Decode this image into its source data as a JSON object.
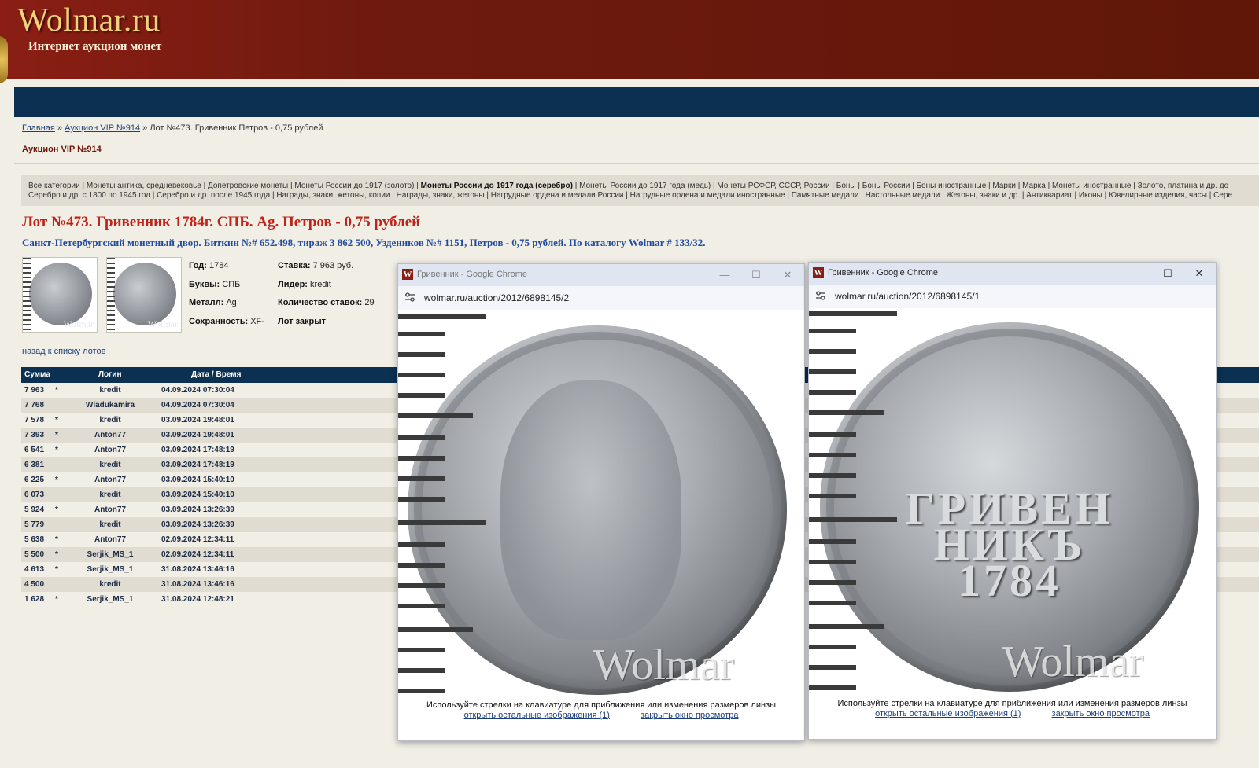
{
  "site": {
    "title": "Wolmar.ru",
    "subtitle": "Интернет аукцион монет"
  },
  "breadcrumb": {
    "home": "Главная",
    "sep1": " » ",
    "auction": "Аукцион VIP №914",
    "sep2": " » ",
    "current": "Лот №473. Гривенник Петров - 0,75 рублей"
  },
  "auction_title": "Аукцион VIP №914",
  "categories": {
    "line1_a": "Все категории | Монеты антика, средневековье | Допетровские монеты | Монеты России до 1917 (золото) | ",
    "line1_bold": "Монеты России до 1917 года (серебро)",
    "line1_b": " | Монеты России до 1917 года (медь) | Монеты РСФСР, СССР, России | Боны | Боны России | Боны иностранные | Марки | Марка | Монеты иностранные | Золото, платина и др. до",
    "line2": "Серебро и др. с 1800 по 1945 год | Серебро и др. после 1945 года | Награды, знаки, жетоны, копии | Награды, знаки, жетоны | Нагрудные ордена и медали России | Нагрудные ордена и медали иностранные | Памятные медали | Настольные медали | Жетоны, знаки и др. | Антиквариат | Иконы | Ювелирные изделия, часы | Сере"
  },
  "lot": {
    "title": "Лот №473.  Гривенник 1784г. СПБ. Ag. Петров - 0,75 рублей",
    "description": "Санкт-Петербургский монетный двор. Биткин №# 652.498, тираж 3 862 500, Уздеников №# 1151, Петров - 0,75 рублей. По каталогу Wolmar # 133/32.",
    "thumb_watermark": "Wolmar",
    "year_label": "Год:",
    "year": "1784",
    "letters_label": "Буквы:",
    "letters": "СПБ",
    "metal_label": "Металл:",
    "metal": "Ag",
    "grade_label": "Сохранность:",
    "grade": "XF-",
    "bid_label": "Ставка:",
    "bid": "7 963 руб.",
    "leader_label": "Лидер:",
    "leader": "kredit",
    "bids_count_label": "Количество ставок:",
    "bids_count": "29",
    "status": "Лот закрыт"
  },
  "back_link": "назад к списку лотов",
  "bids_table": {
    "headers": {
      "sum": "Сумма",
      "login": "Логин",
      "date": "Дата / Время"
    },
    "rows": [
      {
        "sum": "7 963",
        "star": "*",
        "login": "kredit",
        "date": "04.09.2024 07:30:04"
      },
      {
        "sum": "7 768",
        "star": "",
        "login": "Wladukamira",
        "date": "04.09.2024 07:30:04"
      },
      {
        "sum": "7 578",
        "star": "*",
        "login": "kredit",
        "date": "03.09.2024 19:48:01"
      },
      {
        "sum": "7 393",
        "star": "*",
        "login": "Anton77",
        "date": "03.09.2024 19:48:01"
      },
      {
        "sum": "6 541",
        "star": "*",
        "login": "Anton77",
        "date": "03.09.2024 17:48:19"
      },
      {
        "sum": "6 381",
        "star": "",
        "login": "kredit",
        "date": "03.09.2024 17:48:19"
      },
      {
        "sum": "6 225",
        "star": "*",
        "login": "Anton77",
        "date": "03.09.2024 15:40:10"
      },
      {
        "sum": "6 073",
        "star": "",
        "login": "kredit",
        "date": "03.09.2024 15:40:10"
      },
      {
        "sum": "5 924",
        "star": "*",
        "login": "Anton77",
        "date": "03.09.2024 13:26:39"
      },
      {
        "sum": "5 779",
        "star": "",
        "login": "kredit",
        "date": "03.09.2024 13:26:39"
      },
      {
        "sum": "5 638",
        "star": "*",
        "login": "Anton77",
        "date": "02.09.2024 12:34:11"
      },
      {
        "sum": "5 500",
        "star": "*",
        "login": "Serjik_MS_1",
        "date": "02.09.2024 12:34:11"
      },
      {
        "sum": "4 613",
        "star": "*",
        "login": "Serjik_MS_1",
        "date": "31.08.2024 13:46:16"
      },
      {
        "sum": "4 500",
        "star": "",
        "login": "kredit",
        "date": "31.08.2024 13:46:16"
      },
      {
        "sum": "1 628",
        "star": "*",
        "login": "Serjik_MS_1",
        "date": "31.08.2024 12:48:21"
      }
    ]
  },
  "popup_left": {
    "title": "Гривенник - Google Chrome",
    "url": "wolmar.ru/auction/2012/6898145/2",
    "watermark": "Wolmar",
    "hint": "Используйте стрелки на клавиатуре для приближения или изменения размеров линзы",
    "link_other": "открыть остальные изображения (1)",
    "link_close": "закрыть окно просмотра"
  },
  "popup_right": {
    "title": "Гривенник - Google Chrome",
    "url": "wolmar.ru/auction/2012/6898145/1",
    "coin_text": "ГРИВЕН НИКЪ 1784",
    "watermark": "Wolmar",
    "hint": "Используйте стрелки на клавиатуре для приближения или изменения размеров линзы",
    "link_other": "открыть остальные изображения (1)",
    "link_close": "закрыть окно просмотра"
  },
  "window_buttons": {
    "minimize": "—",
    "maximize": "☐",
    "close": "✕"
  },
  "favicon_letter": "W",
  "icons": [
    "minimize-icon",
    "maximize-icon",
    "close-icon",
    "site-settings-icon",
    "wolmar-favicon"
  ],
  "colors": {
    "header": "#6f1a0f",
    "navbar": "#0b3052",
    "lot_title": "#c02418",
    "lot_desc": "#1f4aa0"
  }
}
